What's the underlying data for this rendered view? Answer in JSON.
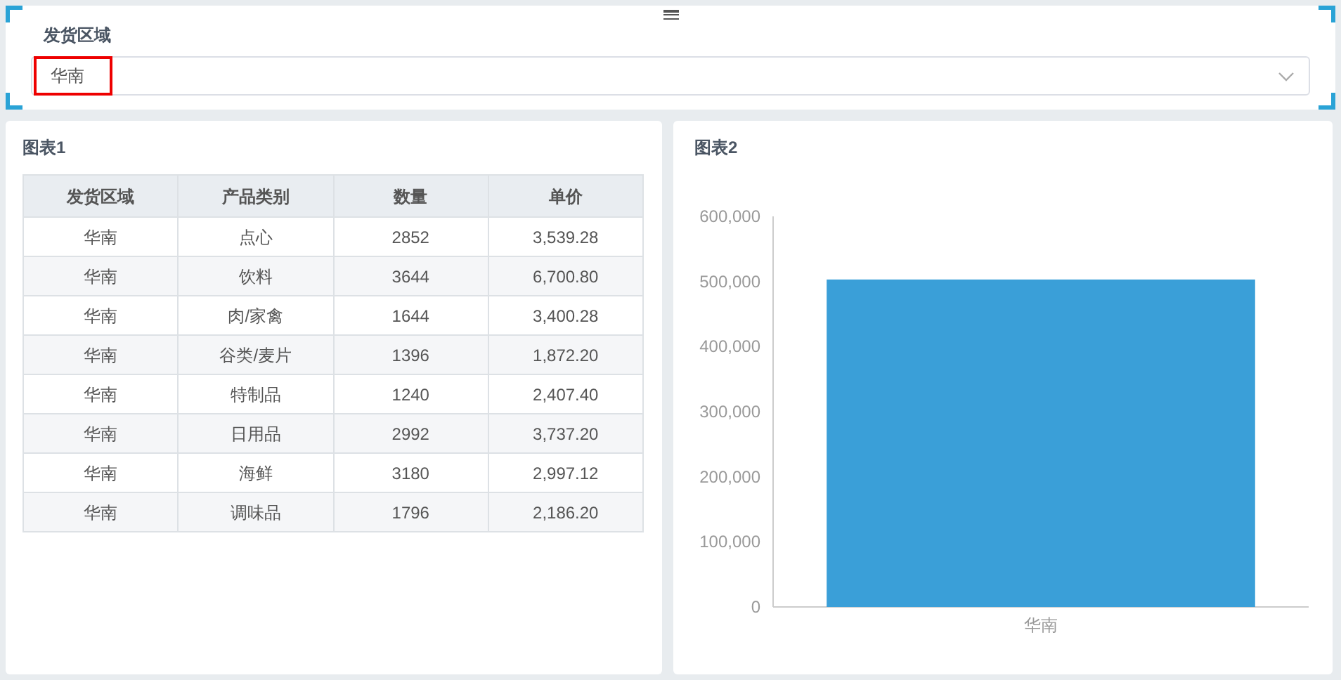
{
  "filter": {
    "label": "发货区域",
    "value": "华南"
  },
  "chart1": {
    "title": "图表1",
    "columns": [
      "发货区域",
      "产品类别",
      "数量",
      "单价"
    ],
    "rows": [
      [
        "华南",
        "点心",
        "2852",
        "3,539.28"
      ],
      [
        "华南",
        "饮料",
        "3644",
        "6,700.80"
      ],
      [
        "华南",
        "肉/家禽",
        "1644",
        "3,400.28"
      ],
      [
        "华南",
        "谷类/麦片",
        "1396",
        "1,872.20"
      ],
      [
        "华南",
        "特制品",
        "1240",
        "2,407.40"
      ],
      [
        "华南",
        "日用品",
        "2992",
        "3,737.20"
      ],
      [
        "华南",
        "海鲜",
        "3180",
        "2,997.12"
      ],
      [
        "华南",
        "调味品",
        "1796",
        "2,186.20"
      ]
    ]
  },
  "chart2": {
    "title": "图表2",
    "chart_data": {
      "type": "bar",
      "categories": [
        "华南"
      ],
      "series": [
        {
          "color": "#3a9fd8",
          "values": [
            503000
          ]
        }
      ],
      "ylim": [
        0,
        600000
      ],
      "yticks": [
        {
          "value": 0,
          "label": "0"
        },
        {
          "value": 100000,
          "label": "100,000"
        },
        {
          "value": 200000,
          "label": "200,000"
        },
        {
          "value": 300000,
          "label": "300,000"
        },
        {
          "value": 400000,
          "label": "400,000"
        },
        {
          "value": 500000,
          "label": "500,000"
        },
        {
          "value": 600000,
          "label": "600,000"
        }
      ]
    }
  }
}
